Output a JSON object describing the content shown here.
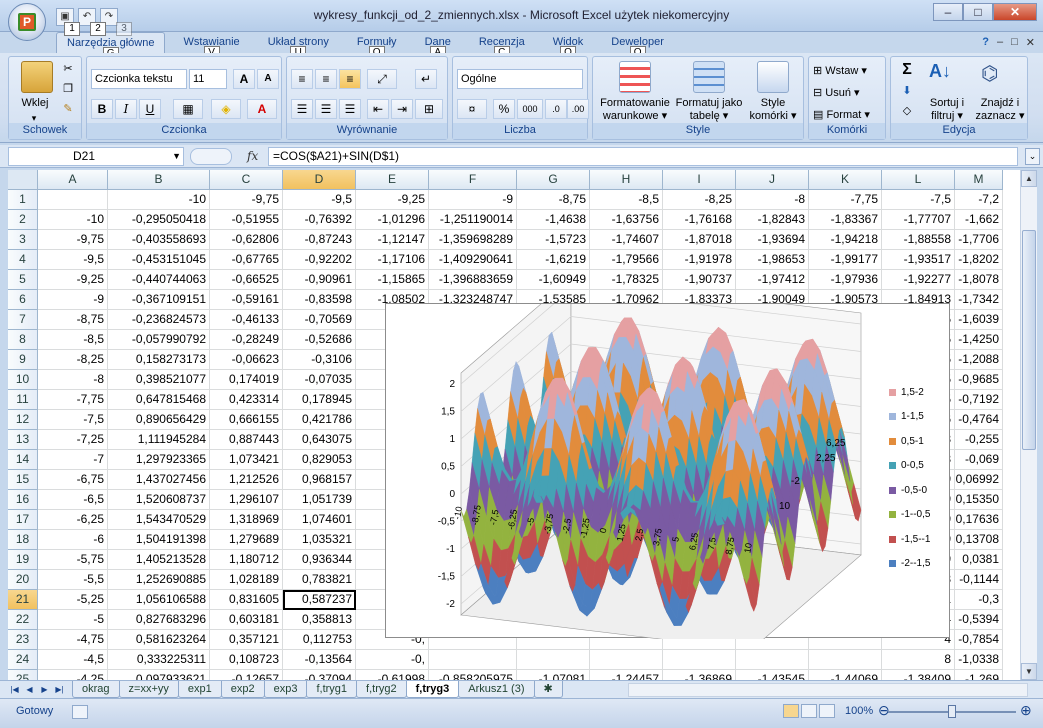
{
  "window": {
    "title": "wykresy_funkcji_od_2_zmiennych.xlsx - Microsoft Excel użytek niekomercyjny",
    "office_logo": "P"
  },
  "qat": {
    "keytips": [
      "1",
      "2",
      "3"
    ]
  },
  "ribbon_tabs": [
    {
      "label": "Narzędzia główne",
      "key": "G",
      "active": true
    },
    {
      "label": "Wstawianie",
      "key": "V"
    },
    {
      "label": "Układ strony",
      "key": "U"
    },
    {
      "label": "Formuły",
      "key": "O"
    },
    {
      "label": "Dane",
      "key": "A"
    },
    {
      "label": "Recenzja",
      "key": "C"
    },
    {
      "label": "Widok",
      "key": "O"
    },
    {
      "label": "Deweloper",
      "key": "Q"
    }
  ],
  "ribbon": {
    "clipboard": {
      "group_label": "Schowek",
      "paste_label": "Wklej"
    },
    "font": {
      "group_label": "Czcionka",
      "font_name": "Czcionka tekstu",
      "font_size": "11",
      "bold": "B",
      "italic": "I",
      "underline": "U",
      "grow": "A",
      "shrink": "A",
      "font_color_letter": "A"
    },
    "alignment": {
      "group_label": "Wyrównanie"
    },
    "number": {
      "group_label": "Liczba",
      "format": "Ogólne",
      "percent": "%",
      "thousands": "000"
    },
    "styles": {
      "group_label": "Style",
      "conditional": "Formatowanie warunkowe ▾",
      "table": "Formatuj jako tabelę ▾",
      "cell_styles": "Style komórki ▾"
    },
    "cells": {
      "group_label": "Komórki",
      "insert": "Wstaw ▾",
      "delete": "Usuń ▾",
      "format": "Format ▾"
    },
    "editing": {
      "group_label": "Edycja",
      "sort": "Sortuj i filtruj ▾",
      "find": "Znajdź i zaznacz ▾",
      "sigma": "Σ"
    }
  },
  "formula_bar": {
    "name_box": "D21",
    "fx": "fx",
    "formula": "=COS($A21)+SIN(D$1)"
  },
  "columns": [
    "A",
    "B",
    "C",
    "D",
    "E",
    "F",
    "G",
    "H",
    "I",
    "J",
    "K",
    "L",
    "M"
  ],
  "selected_column": "D",
  "selected_row": "21",
  "rows": [
    {
      "n": "1",
      "cells": [
        "",
        "-10",
        "-9,75",
        "-9,5",
        "-9,25",
        "-9",
        "-8,75",
        "-8,5",
        "-8,25",
        "-8",
        "-7,75",
        "-7,5",
        "-7,2"
      ]
    },
    {
      "n": "2",
      "cells": [
        "-10",
        "-0,295050418",
        "-0,51955",
        "-0,76392",
        "-1,01296",
        "-1,251190014",
        "-1,4638",
        "-1,63756",
        "-1,76168",
        "-1,82843",
        "-1,83367",
        "-1,77707",
        "-1,662"
      ]
    },
    {
      "n": "3",
      "cells": [
        "-9,75",
        "-0,403558693",
        "-0,62806",
        "-0,87243",
        "-1,12147",
        "-1,359698289",
        "-1,5723",
        "-1,74607",
        "-1,87018",
        "-1,93694",
        "-1,94218",
        "-1,88558",
        "-1,7706"
      ]
    },
    {
      "n": "4",
      "cells": [
        "-9,5",
        "-0,453151045",
        "-0,67765",
        "-0,92202",
        "-1,17106",
        "-1,409290641",
        "-1,6219",
        "-1,79566",
        "-1,91978",
        "-1,98653",
        "-1,99177",
        "-1,93517",
        "-1,8202"
      ]
    },
    {
      "n": "5",
      "cells": [
        "-9,25",
        "-0,440744063",
        "-0,66525",
        "-0,90961",
        "-1,15865",
        "-1,396883659",
        "-1,60949",
        "-1,78325",
        "-1,90737",
        "-1,97412",
        "-1,97936",
        "-1,92277",
        "-1,8078"
      ]
    },
    {
      "n": "6",
      "cells": [
        "-9",
        "-0,367109151",
        "-0,59161",
        "-0,83598",
        "-1,08502",
        "-1,323248747",
        "-1,53585",
        "-1,70962",
        "-1,83373",
        "-1,90049",
        "-1,90573",
        "-1,84913",
        "-1,7342"
      ]
    },
    {
      "n": "7",
      "cells": [
        "-8,75",
        "-0,236824573",
        "-0,46133",
        "-0,70569",
        "-0,",
        "",
        "",
        "",
        "",
        "",
        "",
        "5",
        "-1,6039"
      ]
    },
    {
      "n": "8",
      "cells": [
        "-8,5",
        "-0,057990792",
        "-0,28249",
        "-0,52686",
        "-0,",
        "",
        "",
        "",
        "",
        "",
        "",
        "5",
        "-1,4250"
      ]
    },
    {
      "n": "9",
      "cells": [
        "-8,25",
        "0,158273173",
        "-0,06623",
        "-0,3106",
        "-0,",
        "",
        "",
        "",
        "",
        "",
        "",
        "5",
        "-1,2088"
      ]
    },
    {
      "n": "10",
      "cells": [
        "-8",
        "0,398521077",
        "0,174019",
        "-0,07035",
        "-0,",
        "",
        "",
        "",
        "",
        "",
        "",
        "5",
        "-0,9685"
      ]
    },
    {
      "n": "11",
      "cells": [
        "-7,75",
        "0,647815468",
        "0,423314",
        "0,178945",
        "-0",
        "",
        "",
        "",
        "",
        "",
        "",
        "5",
        "-0,7192"
      ]
    },
    {
      "n": "12",
      "cells": [
        "-7,5",
        "0,890656429",
        "0,666155",
        "0,421786",
        "0,1",
        "",
        "",
        "",
        "",
        "",
        "",
        "6",
        "-0,4764"
      ]
    },
    {
      "n": "13",
      "cells": [
        "-7,25",
        "1,111945284",
        "0,887443",
        "0,643075",
        "0,3",
        "",
        "",
        "",
        "",
        "",
        "",
        "8",
        "-0,255"
      ]
    },
    {
      "n": "14",
      "cells": [
        "-7",
        "1,297923365",
        "1,073421",
        "0,829053",
        "0,5",
        "",
        "",
        "",
        "",
        "",
        "",
        "8",
        "-0,069"
      ]
    },
    {
      "n": "15",
      "cells": [
        "-6,75",
        "1,437027456",
        "1,212526",
        "0,968157",
        "0,7",
        "",
        "",
        "",
        "",
        "",
        "",
        "9",
        "0,06992"
      ]
    },
    {
      "n": "16",
      "cells": [
        "-6,5",
        "1,520608737",
        "1,296107",
        "1,051739",
        "0,8",
        "",
        "",
        "",
        "",
        "",
        "",
        "9",
        "0,15350"
      ]
    },
    {
      "n": "17",
      "cells": [
        "-6,25",
        "1,543470529",
        "1,318969",
        "1,074601",
        "0,",
        "",
        "",
        "",
        "",
        "",
        "",
        "9",
        "0,17636"
      ]
    },
    {
      "n": "18",
      "cells": [
        "-6",
        "1,504191398",
        "1,279689",
        "1,035321",
        "0,7",
        "",
        "",
        "",
        "",
        "",
        "",
        "9",
        "0,13708"
      ]
    },
    {
      "n": "19",
      "cells": [
        "-5,75",
        "1,405213528",
        "1,180712",
        "0,936344",
        "0,6",
        "",
        "",
        "",
        "",
        "",
        "",
        "9",
        "0,0381"
      ]
    },
    {
      "n": "20",
      "cells": [
        "-5,5",
        "1,252690885",
        "1,028189",
        "0,783821",
        "0,",
        "",
        "",
        "",
        "",
        "",
        "",
        "3",
        "-0,1144"
      ]
    },
    {
      "n": "21",
      "cells": [
        "-5,25",
        "1,056106588",
        "0,831605",
        "0,587237",
        "0,3",
        "",
        "",
        "",
        "",
        "",
        "",
        "1",
        "-0,3"
      ]
    },
    {
      "n": "22",
      "cells": [
        "-5",
        "0,827683296",
        "0,603181",
        "0,358813",
        "0,1",
        "",
        "",
        "",
        "",
        "",
        "",
        "4",
        "-0,5394"
      ]
    },
    {
      "n": "23",
      "cells": [
        "-4,75",
        "0,581623264",
        "0,357121",
        "0,112753",
        "-0,",
        "",
        "",
        "",
        "",
        "",
        "",
        "4",
        "-0,7854"
      ]
    },
    {
      "n": "24",
      "cells": [
        "-4,5",
        "0,333225311",
        "0,108723",
        "-0,13564",
        "-0,",
        "",
        "",
        "",
        "",
        "",
        "",
        "8",
        "-1,0338"
      ]
    },
    {
      "n": "25",
      "cells": [
        "-4,25",
        "0,097933621",
        "-0,12657",
        "-0,37094",
        "-0,61998",
        "-0,858205975",
        "-1,07081",
        "-1,24457",
        "-1,36869",
        "-1,43545",
        "-1,44069",
        "-1,38409",
        "-1,269"
      ]
    },
    {
      "n": "26",
      "cells": [
        "-4",
        "-0,10962251",
        "-0,33412",
        "-0,57849",
        "-0,82753",
        "-1,065762106",
        "-1,27837",
        "-1,45213",
        "-1,57625",
        "-1,643",
        "-1,64824",
        "-1,59164",
        "-1,4767"
      ]
    }
  ],
  "chart": {
    "z_ticks": [
      "2",
      "1,5",
      "1",
      "0,5",
      "0",
      "-0,5",
      "-1",
      "-1,5",
      "-2"
    ],
    "x_ticks": [
      "-10",
      "-8,75",
      "-7,5",
      "-6,25",
      "-5",
      "-3,75",
      "-2,5",
      "-1,25",
      "0",
      "1,25",
      "2,5",
      "3,75",
      "5",
      "6,25",
      "7,5",
      "8,75",
      "10"
    ],
    "depth_labels": [
      "6,25",
      "2,25",
      "10",
      "-2"
    ],
    "legend": [
      {
        "label": "1,5-2",
        "color": "#e5a0a2"
      },
      {
        "label": "1-1,5",
        "color": "#9fb6dc"
      },
      {
        "label": "0,5-1",
        "color": "#e28c3c"
      },
      {
        "label": "0-0,5",
        "color": "#45a2b5"
      },
      {
        "label": "-0,5-0",
        "color": "#7a5aa3"
      },
      {
        "label": "-1--0,5",
        "color": "#93b33f"
      },
      {
        "label": "-1,5--1",
        "color": "#c2504f"
      },
      {
        "label": "-2--1,5",
        "color": "#4c7fc0"
      }
    ]
  },
  "sheet_tabs": [
    "okrag",
    "z=xx+yy",
    "exp1",
    "exp2",
    "exp3",
    "f,tryg1",
    "f,tryg2",
    "f,tryg3",
    "Arkusz1 (3)"
  ],
  "active_sheet": "f,tryg3",
  "status": {
    "mode": "Gotowy",
    "zoom": "100%",
    "zoom_level_fraction": 0.5
  }
}
